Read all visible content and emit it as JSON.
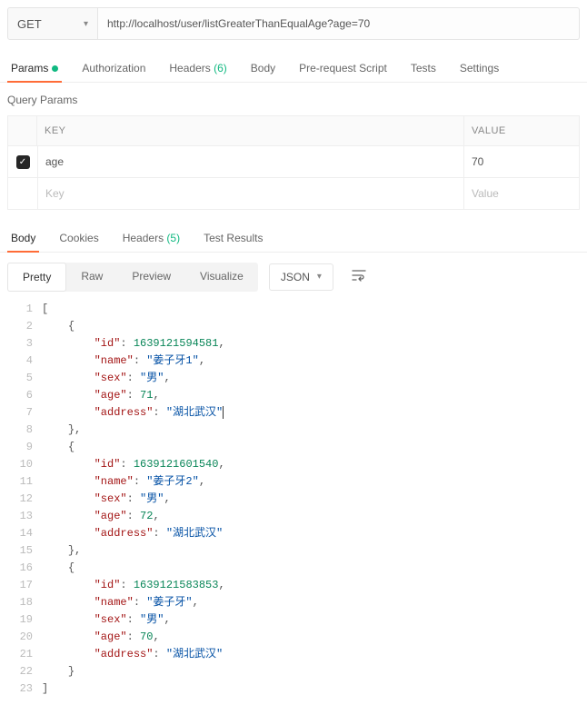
{
  "request": {
    "method": "GET",
    "url": "http://localhost/user/listGreaterThanEqualAge?age=70"
  },
  "tabs": {
    "params": "Params",
    "authorization": "Authorization",
    "headers": "Headers",
    "headers_count": "(6)",
    "body": "Body",
    "prerequest": "Pre-request Script",
    "tests": "Tests",
    "settings": "Settings"
  },
  "query_params_label": "Query Params",
  "params_table": {
    "key_header": "KEY",
    "value_header": "VALUE",
    "key_placeholder": "Key",
    "value_placeholder": "Value",
    "rows": [
      {
        "key": "age",
        "value": "70",
        "checked": true
      }
    ]
  },
  "body_tabs": {
    "body": "Body",
    "cookies": "Cookies",
    "headers": "Headers",
    "headers_count": "(5)",
    "test_results": "Test Results"
  },
  "subtabs": {
    "pretty": "Pretty",
    "raw": "Raw",
    "preview": "Preview",
    "visualize": "Visualize",
    "format": "JSON"
  },
  "response_lines": [
    {
      "n": 1,
      "indent": 0,
      "tokens": [
        {
          "t": "brace",
          "v": "["
        }
      ]
    },
    {
      "n": 2,
      "indent": 1,
      "tokens": [
        {
          "t": "brace",
          "v": "{"
        }
      ]
    },
    {
      "n": 3,
      "indent": 2,
      "tokens": [
        {
          "t": "key",
          "v": "\"id\""
        },
        {
          "t": "plain",
          "v": ": "
        },
        {
          "t": "number",
          "v": "1639121594581"
        },
        {
          "t": "plain",
          "v": ","
        }
      ]
    },
    {
      "n": 4,
      "indent": 2,
      "tokens": [
        {
          "t": "key",
          "v": "\"name\""
        },
        {
          "t": "plain",
          "v": ": "
        },
        {
          "t": "string",
          "v": "\"姜子牙1\""
        },
        {
          "t": "plain",
          "v": ","
        }
      ]
    },
    {
      "n": 5,
      "indent": 2,
      "tokens": [
        {
          "t": "key",
          "v": "\"sex\""
        },
        {
          "t": "plain",
          "v": ": "
        },
        {
          "t": "string",
          "v": "\"男\""
        },
        {
          "t": "plain",
          "v": ","
        }
      ]
    },
    {
      "n": 6,
      "indent": 2,
      "tokens": [
        {
          "t": "key",
          "v": "\"age\""
        },
        {
          "t": "plain",
          "v": ": "
        },
        {
          "t": "number",
          "v": "71"
        },
        {
          "t": "plain",
          "v": ","
        }
      ]
    },
    {
      "n": 7,
      "indent": 2,
      "tokens": [
        {
          "t": "key",
          "v": "\"address\""
        },
        {
          "t": "plain",
          "v": ": "
        },
        {
          "t": "string",
          "v": "\"湖北武汉\""
        }
      ],
      "cursor": true
    },
    {
      "n": 8,
      "indent": 1,
      "tokens": [
        {
          "t": "brace",
          "v": "},"
        }
      ]
    },
    {
      "n": 9,
      "indent": 1,
      "tokens": [
        {
          "t": "brace",
          "v": "{"
        }
      ]
    },
    {
      "n": 10,
      "indent": 2,
      "tokens": [
        {
          "t": "key",
          "v": "\"id\""
        },
        {
          "t": "plain",
          "v": ": "
        },
        {
          "t": "number",
          "v": "1639121601540"
        },
        {
          "t": "plain",
          "v": ","
        }
      ]
    },
    {
      "n": 11,
      "indent": 2,
      "tokens": [
        {
          "t": "key",
          "v": "\"name\""
        },
        {
          "t": "plain",
          "v": ": "
        },
        {
          "t": "string",
          "v": "\"姜子牙2\""
        },
        {
          "t": "plain",
          "v": ","
        }
      ]
    },
    {
      "n": 12,
      "indent": 2,
      "tokens": [
        {
          "t": "key",
          "v": "\"sex\""
        },
        {
          "t": "plain",
          "v": ": "
        },
        {
          "t": "string",
          "v": "\"男\""
        },
        {
          "t": "plain",
          "v": ","
        }
      ]
    },
    {
      "n": 13,
      "indent": 2,
      "tokens": [
        {
          "t": "key",
          "v": "\"age\""
        },
        {
          "t": "plain",
          "v": ": "
        },
        {
          "t": "number",
          "v": "72"
        },
        {
          "t": "plain",
          "v": ","
        }
      ]
    },
    {
      "n": 14,
      "indent": 2,
      "tokens": [
        {
          "t": "key",
          "v": "\"address\""
        },
        {
          "t": "plain",
          "v": ": "
        },
        {
          "t": "string",
          "v": "\"湖北武汉\""
        }
      ]
    },
    {
      "n": 15,
      "indent": 1,
      "tokens": [
        {
          "t": "brace",
          "v": "},"
        }
      ]
    },
    {
      "n": 16,
      "indent": 1,
      "tokens": [
        {
          "t": "brace",
          "v": "{"
        }
      ]
    },
    {
      "n": 17,
      "indent": 2,
      "tokens": [
        {
          "t": "key",
          "v": "\"id\""
        },
        {
          "t": "plain",
          "v": ": "
        },
        {
          "t": "number",
          "v": "1639121583853"
        },
        {
          "t": "plain",
          "v": ","
        }
      ]
    },
    {
      "n": 18,
      "indent": 2,
      "tokens": [
        {
          "t": "key",
          "v": "\"name\""
        },
        {
          "t": "plain",
          "v": ": "
        },
        {
          "t": "string",
          "v": "\"姜子牙\""
        },
        {
          "t": "plain",
          "v": ","
        }
      ]
    },
    {
      "n": 19,
      "indent": 2,
      "tokens": [
        {
          "t": "key",
          "v": "\"sex\""
        },
        {
          "t": "plain",
          "v": ": "
        },
        {
          "t": "string",
          "v": "\"男\""
        },
        {
          "t": "plain",
          "v": ","
        }
      ]
    },
    {
      "n": 20,
      "indent": 2,
      "tokens": [
        {
          "t": "key",
          "v": "\"age\""
        },
        {
          "t": "plain",
          "v": ": "
        },
        {
          "t": "number",
          "v": "70"
        },
        {
          "t": "plain",
          "v": ","
        }
      ]
    },
    {
      "n": 21,
      "indent": 2,
      "tokens": [
        {
          "t": "key",
          "v": "\"address\""
        },
        {
          "t": "plain",
          "v": ": "
        },
        {
          "t": "string",
          "v": "\"湖北武汉\""
        }
      ]
    },
    {
      "n": 22,
      "indent": 1,
      "tokens": [
        {
          "t": "brace",
          "v": "}"
        }
      ]
    },
    {
      "n": 23,
      "indent": 0,
      "tokens": [
        {
          "t": "brace",
          "v": "]"
        }
      ]
    }
  ]
}
